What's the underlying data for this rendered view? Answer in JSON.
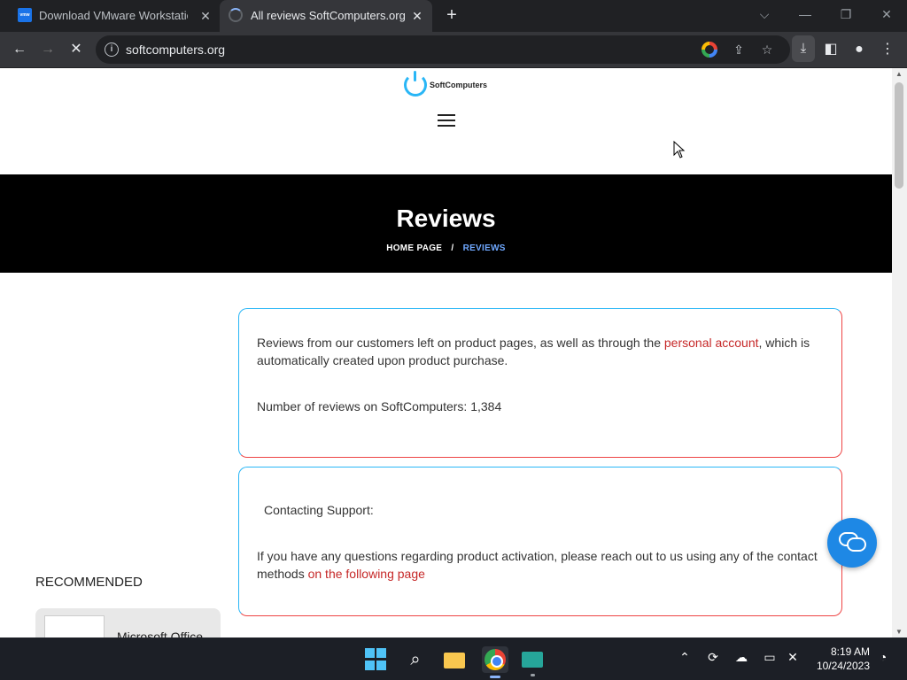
{
  "browser": {
    "tabs": [
      {
        "title": "Download VMware Workstation",
        "favicon": "vmw"
      },
      {
        "title": "All reviews SoftComputers.org"
      }
    ],
    "url": "softcomputers.org"
  },
  "site": {
    "brand": "SoftComputers",
    "hero_title": "Reviews",
    "breadcrumb": {
      "home": "HOME PAGE",
      "separator": "/",
      "current": "REVIEWS"
    },
    "card1": {
      "text_before": "Reviews from our customers left on product pages, as well as through the ",
      "link": "personal account",
      "text_after": ", which is automatically created upon product purchase.",
      "count_label": "Number of reviews on SoftComputers: ",
      "count_value": "1,384"
    },
    "card2": {
      "heading": "Contacting Support:",
      "text_before": "If you have any questions regarding product activation, please reach out to us using any of the contact methods ",
      "link": "on the following page"
    },
    "recommended_heading": "RECOMMENDED",
    "recommended_item": "Microsoft Office",
    "accent_color": "#1e88e5",
    "link_color": "#c62828"
  },
  "taskbar": {
    "time": "8:19 AM",
    "date": "10/24/2023"
  }
}
